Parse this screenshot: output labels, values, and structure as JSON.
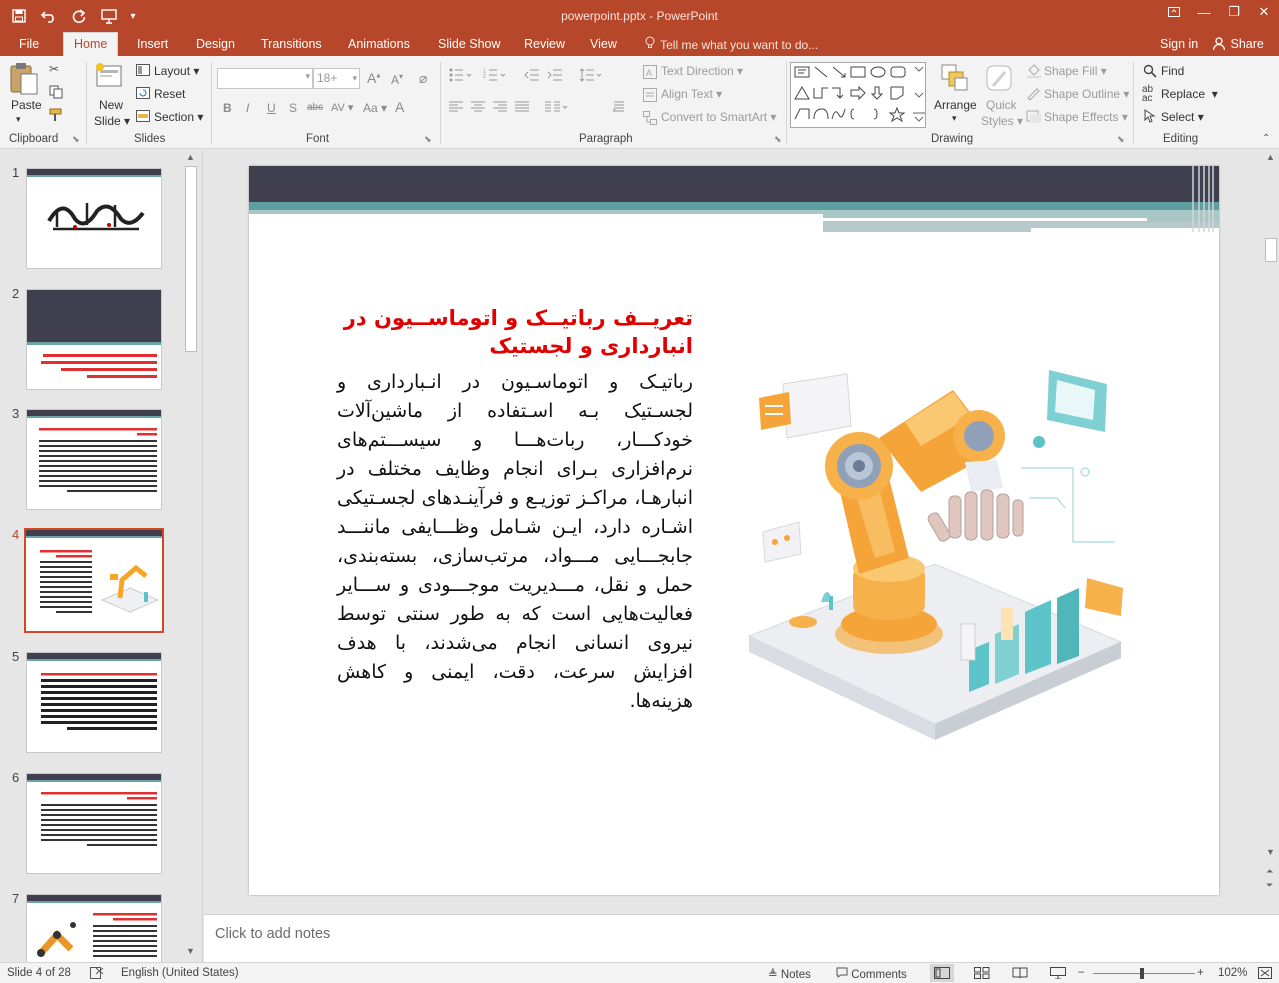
{
  "window": {
    "title": "powerpoint.pptx - PowerPoint",
    "minimize": "—",
    "restore": "❐",
    "close": "✕"
  },
  "qat": {
    "save": "save-icon",
    "undo": "undo-icon",
    "redo": "redo-icon",
    "present": "present-icon",
    "customize": "▾"
  },
  "menu": {
    "tabs": [
      "File",
      "Home",
      "Insert",
      "Design",
      "Transitions",
      "Animations",
      "Slide Show",
      "Review",
      "View"
    ],
    "active": "Home",
    "tell_me": "Tell me what you want to do...",
    "sign_in": "Sign in",
    "share": "Share"
  },
  "ribbon": {
    "clipboard": {
      "label": "Clipboard",
      "paste": "Paste"
    },
    "slides": {
      "label": "Slides",
      "new_slide": "New",
      "new_slide_2": "Slide",
      "layout": "Layout",
      "reset": "Reset",
      "section": "Section"
    },
    "font": {
      "label": "Font",
      "font_name": "",
      "font_size": "18+",
      "bold": "B",
      "italic": "I",
      "underline": "U",
      "shadow": "S",
      "strike": "abc",
      "spacing": "AV",
      "case": "Aa"
    },
    "paragraph": {
      "label": "Paragraph",
      "text_direction": "Text Direction",
      "align_text": "Align Text",
      "smartart": "Convert to SmartArt"
    },
    "drawing": {
      "label": "Drawing",
      "arrange": "Arrange",
      "quick_styles": "Quick",
      "quick_styles_2": "Styles",
      "shape_fill": "Shape Fill",
      "shape_outline": "Shape Outline",
      "shape_effects": "Shape Effects"
    },
    "editing": {
      "label": "Editing",
      "find": "Find",
      "replace": "Replace",
      "select": "Select"
    }
  },
  "thumbnails": {
    "numbers": [
      "1",
      "2",
      "3",
      "4",
      "5",
      "6",
      "7"
    ],
    "active": "4"
  },
  "slide": {
    "title": "تعریــف رباتیــک و اتوماســیون در انبارداری و لجستیک",
    "body": "رباتیـک و اتوماسـیون در انـبارداری و لجسـتیک بـه اسـتفاده از ماشین‌آلات خودکـــار، ربات‌هـــا و سیســـتم‌های نرم‌افزاری بـرای انجام وظایف مختلف در انبارهـا، مراکـز توزیـع و فرآینـدهای لجسـتیکی اشـاره دارد، ایـن شـامل وظـــایفی ماننـــد جابجـــایی مـــواد، مرتب‌سازی، بسته‌بندی، حمل و نقل، مـــدیریت موجـــودی و ســـایر فعالیت‌هایی است که به طور سنتی توسط نیروی انسانی انجام می‌شدند، با هدف افزایش سرعت، دقت، ایمنی و کاهش هزینه‌ها.",
    "image": "robotic-arm-illustration"
  },
  "notes": {
    "placeholder": "Click to add notes"
  },
  "status": {
    "slide_count": "Slide 4 of 28",
    "language": "English (United States)",
    "notes": "Notes",
    "comments": "Comments",
    "zoom": "102%",
    "zoom_minus": "−",
    "zoom_plus": "+"
  },
  "colors": {
    "accent": "#b7472a",
    "title_red": "#e00000",
    "header_dark": "#3f3f4f",
    "teal": "#5f9ea0"
  }
}
